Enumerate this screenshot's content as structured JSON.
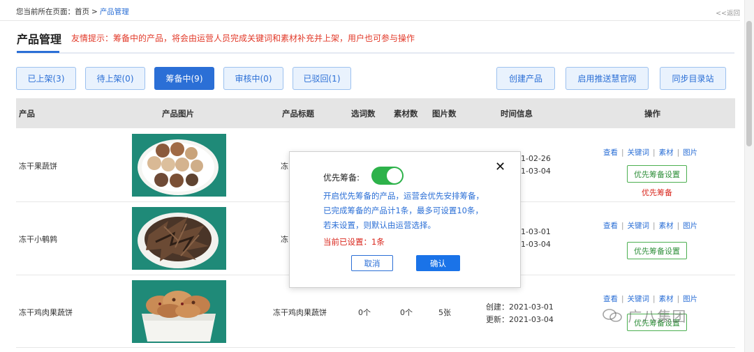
{
  "breadcrumb": {
    "prefix": "您当前所在页面：",
    "home": "首页",
    "sep": ">",
    "current": "产品管理"
  },
  "back_link": "<<返回",
  "page_title": "产品管理",
  "tip": "友情提示：筹备中的产品，将会由运营人员完成关键词和素材补充并上架，用户也可参与操作",
  "status_tabs": [
    {
      "label": "已上架(3)",
      "active": false
    },
    {
      "label": "待上架(0)",
      "active": false
    },
    {
      "label": "筹备中(9)",
      "active": true
    },
    {
      "label": "审核中(0)",
      "active": false
    },
    {
      "label": "已驳回(1)",
      "active": false
    }
  ],
  "actions": [
    "创建产品",
    "启用推送慧官网",
    "同步目录站"
  ],
  "table": {
    "columns": [
      "产品",
      "产品图片",
      "产品标题",
      "选词数",
      "素材数",
      "图片数",
      "时间信息",
      "操作"
    ],
    "rows": [
      {
        "name": "冻干果蔬饼",
        "title_partial": "冻",
        "created_partial": "1-02-26",
        "updated_partial": "1-03-04",
        "has_note": true
      },
      {
        "name": "冻干小鹌鹑",
        "title_partial": "冻",
        "created_partial": "1-03-01",
        "updated_partial": "1-03-04",
        "has_note": false
      },
      {
        "name": "冻干鸡肉果蔬饼",
        "title": "冻干鸡肉果蔬饼",
        "words": "0个",
        "materials": "0个",
        "images": "5张",
        "created_label": "创建：",
        "created": "2021-03-01",
        "updated_label": "更新：",
        "updated": "2021-03-04",
        "has_note": false
      }
    ],
    "ops_links": [
      "查看",
      "关键词",
      "素材",
      "图片"
    ],
    "ops_sep": "|",
    "priority_button": "优先筹备设置",
    "priority_note": "优先筹备"
  },
  "modal": {
    "toggle_label": "优先筹备:",
    "toggle_on": true,
    "close": "✕",
    "desc_lines": [
      "开启优先筹备的产品，运营会优先安排筹备，",
      "已完成筹备的产品计1条，最多可设置10条，",
      "若未设置，则默认由运营选择。"
    ],
    "current": "当前已设置：1条",
    "cancel": "取消",
    "confirm": "确认"
  },
  "watermark": "广八集团",
  "colors": {
    "accent": "#2b6fd6",
    "danger": "#d9261c",
    "success": "#2db24a",
    "header_bg": "#e5e5e5"
  }
}
